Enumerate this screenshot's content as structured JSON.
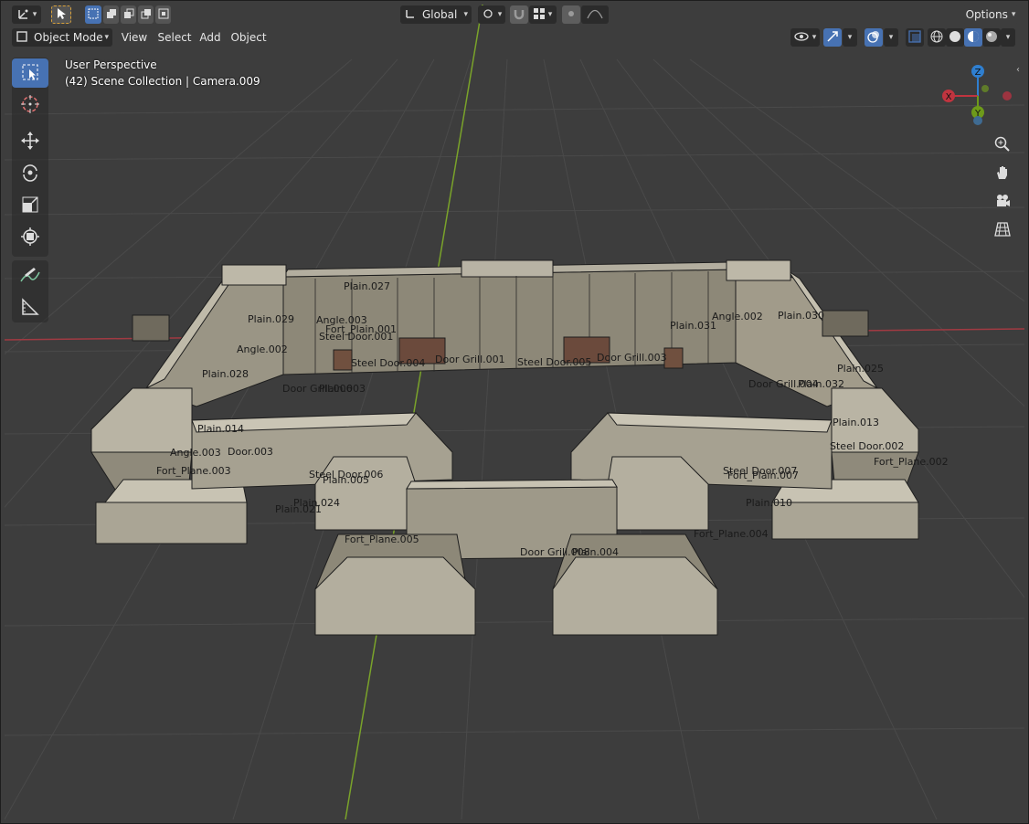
{
  "header": {
    "editor_type_icon": "axes-gizmo-icon",
    "select_mode_icon": "cursor-arrow-icon",
    "transform_orientation": "Global",
    "options_label": "Options",
    "mode_label": "Object Mode",
    "menu": [
      "View",
      "Select",
      "Add",
      "Object"
    ]
  },
  "overlay": {
    "view_name": "User Perspective",
    "collection_info": "(42) Scene Collection | Camera.009"
  },
  "toolbar": {
    "tools": [
      "select-box-icon",
      "cursor-icon",
      "move-icon",
      "rotate-icon",
      "scale-icon",
      "transform-icon",
      "annotate-icon",
      "measure-icon"
    ],
    "active_tool": "select-box-icon"
  },
  "gizmo": {
    "z": "Z",
    "x": "X",
    "y": "Y"
  },
  "colors": {
    "accent": "#4772b3",
    "x_axis": "#c0343f",
    "y_axis": "#6e9a1a",
    "z_axis": "#2f7fd0",
    "grid_bg": "#3d3d3d"
  },
  "object_labels": [
    "Plain.027",
    "Plain.029",
    "Angle.003",
    "Fort_Plain.001",
    "Steel Door.001",
    "Plain.030",
    "Plain.031",
    "Angle.002",
    "Plain.028",
    "Angle.002",
    "Steel Door.004",
    "Door Grill.001",
    "Steel Door.005",
    "Door Grill.003",
    "Plain.025",
    "Door Grill.006",
    "Plain.003",
    "Door Grill.004",
    "Plain.032",
    "Plain.014",
    "Plain.013",
    "Angle.003",
    "Door.003",
    "Steel Door.002",
    "Fort_Plane.003",
    "Steel Door.006",
    "Fort_Plane.002",
    "Plain.005",
    "Steel Door.007",
    "Fort_Plain.007",
    "Plain.010",
    "Plain.024",
    "Plain.021",
    "Fort_Plane.005",
    "Fort_Plane.004",
    "Door Grill.008",
    "Plain.004"
  ]
}
